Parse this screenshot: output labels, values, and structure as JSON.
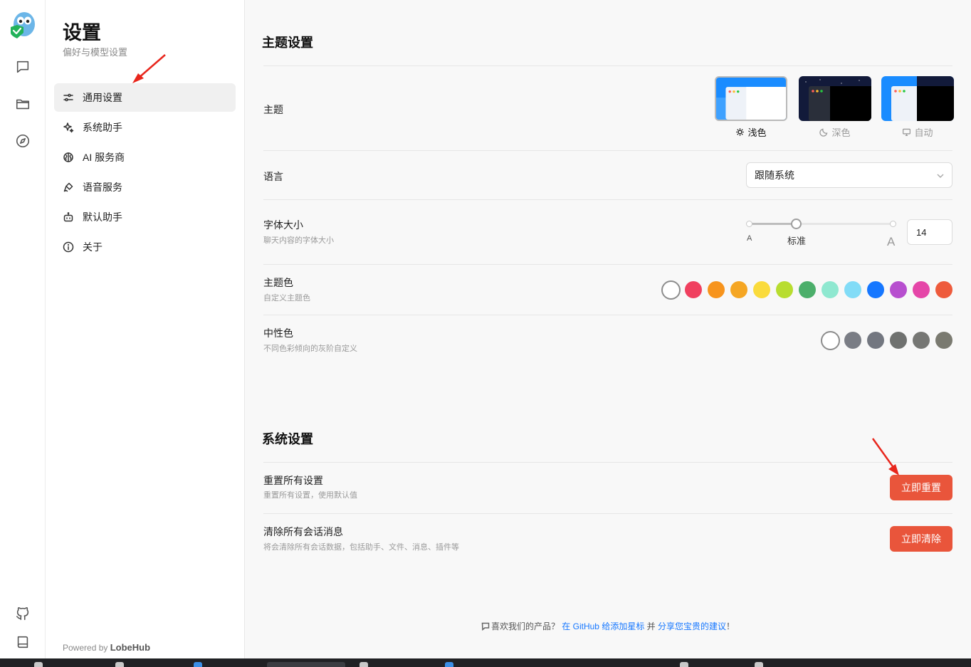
{
  "sidebar_rail": {
    "icons": [
      "chat-icon",
      "folder-icon",
      "compass-icon",
      "github-icon",
      "book-icon"
    ]
  },
  "settings_menu": {
    "title": "设置",
    "subtitle": "偏好与模型设置",
    "items": [
      {
        "label": "通用设置",
        "icon": "sliders-icon",
        "active": true
      },
      {
        "label": "系统助手",
        "icon": "sparkles-icon",
        "active": false
      },
      {
        "label": "AI 服务商",
        "icon": "brain-icon",
        "active": false
      },
      {
        "label": "语音服务",
        "icon": "mic-icon",
        "active": false
      },
      {
        "label": "默认助手",
        "icon": "bot-icon",
        "active": false
      },
      {
        "label": "关于",
        "icon": "info-icon",
        "active": false
      }
    ],
    "powered_by_prefix": "Powered by",
    "powered_by_brand": "LobeHub"
  },
  "theme_section": {
    "title": "主题设置",
    "theme": {
      "label": "主题",
      "options": [
        {
          "label": "浅色",
          "icon": "sun-icon",
          "selected": true
        },
        {
          "label": "深色",
          "icon": "moon-icon",
          "selected": false
        },
        {
          "label": "自动",
          "icon": "monitor-icon",
          "selected": false
        }
      ]
    },
    "language": {
      "label": "语言",
      "value": "跟随系统"
    },
    "font_size": {
      "label": "字体大小",
      "description": "聊天内容的字体大小",
      "value": "14",
      "marks": [
        "A",
        "标准",
        "A"
      ],
      "slider_fraction": 0.33
    },
    "primary_color": {
      "label": "主题色",
      "description": "自定义主题色",
      "colors": [
        "#ffffff",
        "#f0405f",
        "#f7941d",
        "#f5a623",
        "#fadb3c",
        "#b8dd30",
        "#4caf6b",
        "#8fe8d0",
        "#82dcf7",
        "#1677ff",
        "#b74fcf",
        "#e546a8",
        "#ee5b3c"
      ],
      "selected_index": 0
    },
    "neutral_color": {
      "label": "中性色",
      "description": "不同色彩倾向的灰阶自定义",
      "colors": [
        "#ffffff",
        "#7a7d85",
        "#737780",
        "#6f716f",
        "#767774",
        "#7a7a70"
      ],
      "selected_index": 0
    }
  },
  "system_section": {
    "title": "系统设置",
    "reset": {
      "label": "重置所有设置",
      "description": "重置所有设置，使用默认值",
      "button": "立即重置"
    },
    "clear": {
      "label": "清除所有会话消息",
      "description": "将会清除所有会话数据，包括助手、文件、消息、插件等",
      "button": "立即清除"
    }
  },
  "footer": {
    "prefix": "喜欢我们的产品？",
    "link1": "在 GitHub 给添加星标",
    "middle": "并",
    "link2": "分享您宝贵的建议",
    "suffix": "！"
  },
  "colors": {
    "danger": "#e9553b",
    "link": "#1677ff",
    "active_menu_bg": "#f0f0f0"
  }
}
